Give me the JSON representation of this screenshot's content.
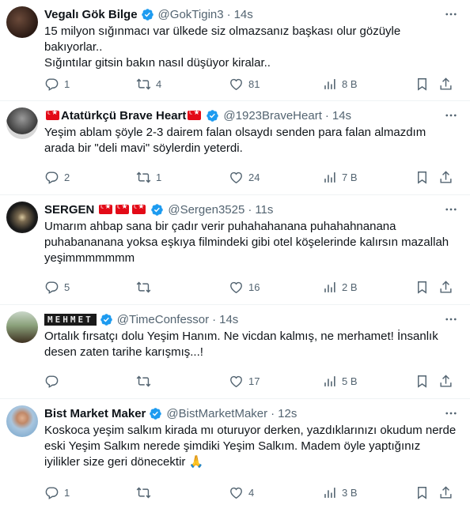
{
  "tweets": [
    {
      "name": "Vegalı Gök Bilge",
      "flags": 0,
      "handle": "@GokTigin3",
      "time": "14s",
      "text": "15 milyon sığınmacı var ülkede siz olmazsanız başkası olur gözüyle bakıyorlar..\nSığıntılar gitsin bakın nasıl düşüyor kiralar..",
      "replies": "1",
      "retweets": "4",
      "likes": "81",
      "views": "8 B"
    },
    {
      "name": "Atatürkçü Brave Heart",
      "flags": 2,
      "handle": "@1923BraveHeart",
      "time": "14s",
      "text": "Yeşim ablam şöyle 2-3 dairem falan olsaydı senden para falan almazdım arada bir \"deli mavi\" söylerdin yeterdi.",
      "replies": "2",
      "retweets": "1",
      "likes": "24",
      "views": "7 B"
    },
    {
      "name": "SERGEN",
      "flags": 3,
      "handle": "@Sergen3525",
      "time": "11s",
      "text": "Umarım ahbap sana bir çadır verir puhahahanana puhahahnanana puhabananana yoksa eşkıya filmindeki gibi otel köşelerinde kalırsın mazallah yeşimmmmmmm",
      "replies": "5",
      "retweets": "",
      "likes": "16",
      "views": "2 B"
    },
    {
      "name": "MEHMET",
      "flags": 0,
      "handle": "@TimeConfessor",
      "time": "14s",
      "text": "Ortalık fırsatçı dolu Yeşim Hanım. Ne vicdan kalmış, ne merhamet! İnsanlık desen zaten tarihe karışmış...!",
      "replies": "",
      "retweets": "",
      "likes": "17",
      "views": "5 B"
    },
    {
      "name": "Bist Market Maker",
      "flags": 0,
      "handle": "@BistMarketMaker",
      "time": "12s",
      "text": "Koskoca yeşim salkım kirada mı oturuyor derken, yazdıklarınızı okudum nerde eski Yeşim Salkım nerede şimdiki Yeşim Salkım. Madem öyle yaptığınız iyilikler size geri dönecektir 🙏",
      "replies": "1",
      "retweets": "",
      "likes": "4",
      "views": "3 B"
    }
  ],
  "colors": {
    "verified": "#1d9bf0",
    "muted": "#536471",
    "text": "#0f1419",
    "border": "#eff3f4"
  },
  "icons": [
    "verified-badge-icon",
    "more-icon",
    "reply-icon",
    "retweet-icon",
    "like-icon",
    "views-icon",
    "bookmark-icon",
    "share-icon"
  ]
}
